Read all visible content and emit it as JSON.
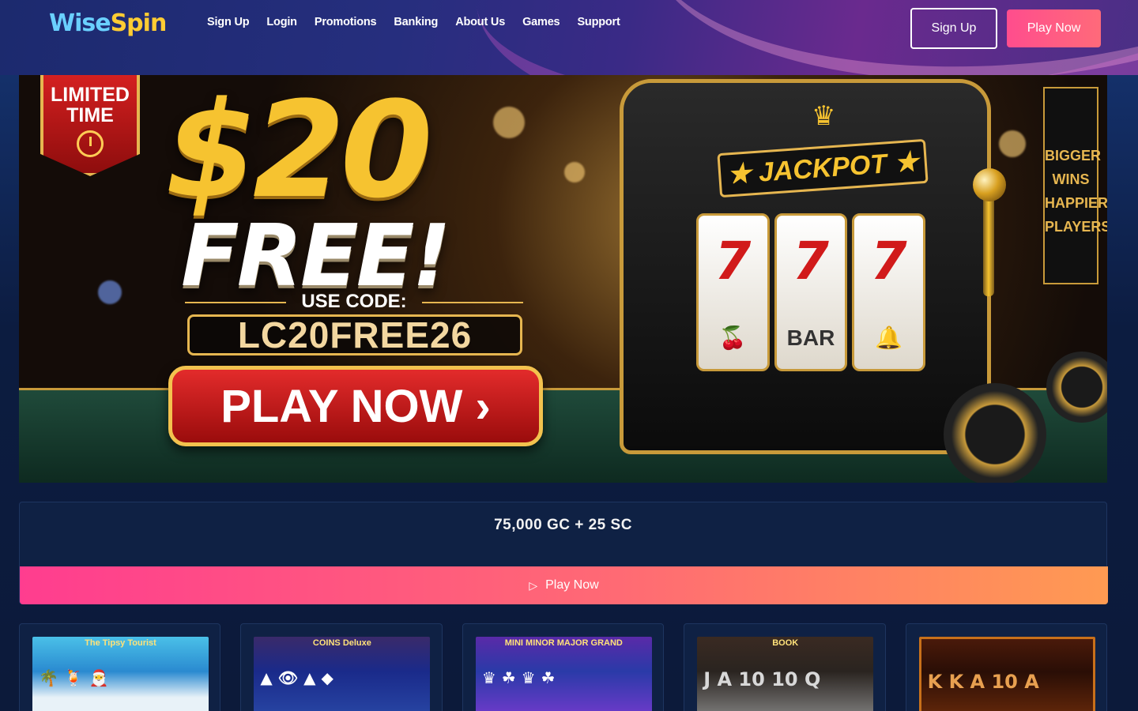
{
  "header": {
    "logo_part1": "Wise",
    "logo_part2": "Spin",
    "nav": [
      {
        "label": "Sign Up"
      },
      {
        "label": "Login"
      },
      {
        "label": "Promotions"
      },
      {
        "label": "Banking"
      },
      {
        "label": "About Us"
      },
      {
        "label": "Games"
      },
      {
        "label": "Support"
      }
    ],
    "signup_label": "Sign Up",
    "playnow_label": "Play Now"
  },
  "hero": {
    "badge_line1": "LIMITED",
    "badge_line2": "TIME",
    "amount": "$20",
    "free": "FREE!",
    "use_code": "USE CODE:",
    "code": "LC20FREE26",
    "play_label": "PLAY NOW ›",
    "jackpot": "★ JACKPOT ★",
    "reel_symbol_1": "7",
    "reel_symbol_2": "7",
    "reel_symbol_3": "7",
    "reel_bottom_2": "BAR",
    "sign_text": "BIGGER WINS HAPPIER PLAYERS"
  },
  "offer": {
    "amount": "75,000 GC + 25 SC",
    "play_label": "Play Now"
  },
  "games": [
    {
      "title": "The Tipsy Tourist",
      "row": "🌴 🍹 🎅"
    },
    {
      "title": "COINS Deluxe",
      "row": "▲ 👁 ▲ ◆"
    },
    {
      "title": "MINI MINOR MAJOR GRAND",
      "row": "♛ ☘ ♛ ☘"
    },
    {
      "title": "BOOK",
      "row": "J A 10 10 Q"
    },
    {
      "title": "",
      "row": "K K A 10 A"
    }
  ],
  "colors": {
    "accent_pink": "#ff4d8d",
    "accent_orange": "#ff9a52",
    "gold": "#f6c330",
    "bg": "#0c1a3a"
  }
}
